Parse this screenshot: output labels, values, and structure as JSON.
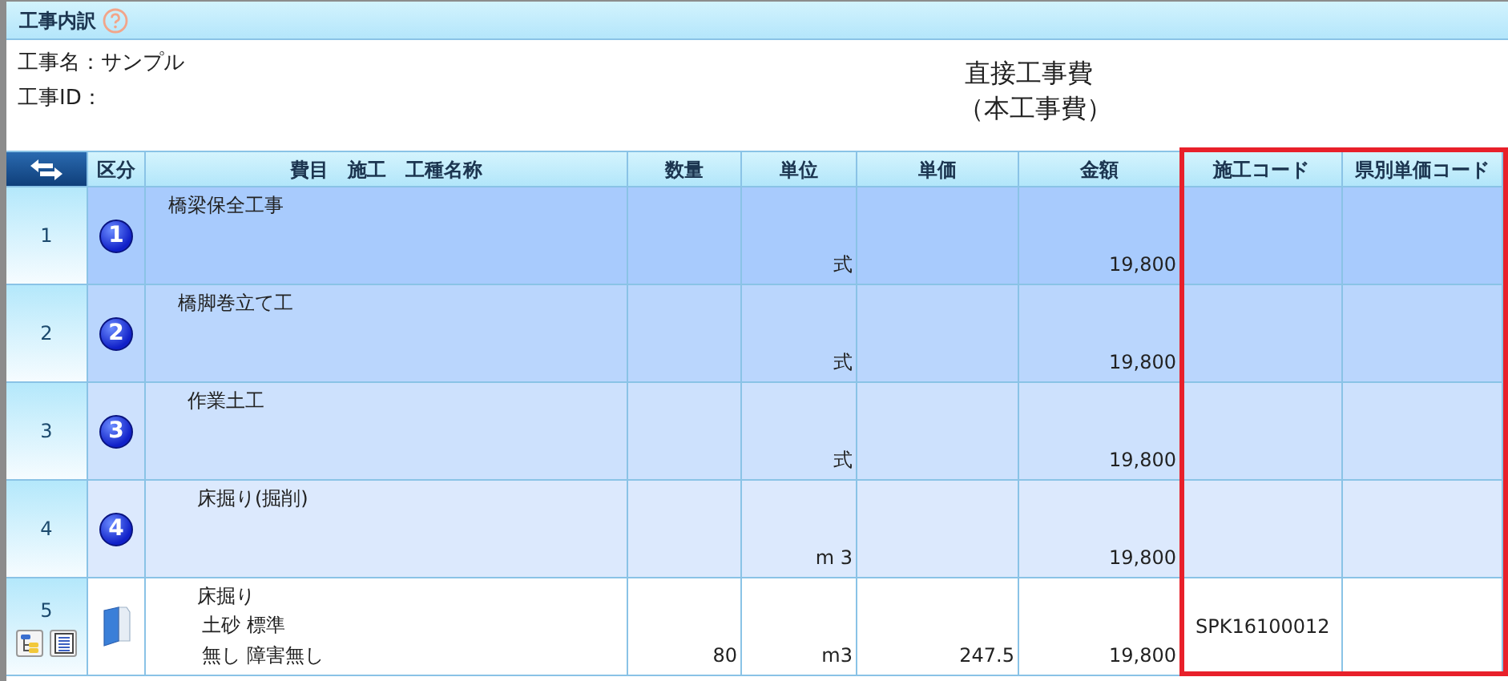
{
  "panel": {
    "title": "工事内訳"
  },
  "info": {
    "lines": [
      "工事名：サンプル",
      "工事ID："
    ],
    "heading": [
      "直接工事費",
      "（本工事費）"
    ]
  },
  "table": {
    "columns": [
      "区分",
      "費目　施工　工種名称",
      "数量",
      "単位",
      "単価",
      "金額",
      "施工コード",
      "県別単価コード"
    ],
    "rows": [
      {
        "no": "1",
        "kind": "group",
        "badge": "1",
        "name": "橋梁保全工事",
        "unit": "式",
        "amount": "19,800",
        "children": [
          {
            "no": "2",
            "kind": "group",
            "badge": "2",
            "name": "橋脚巻立て工",
            "unit": "式",
            "amount": "19,800",
            "children": [
              {
                "no": "3",
                "kind": "group",
                "badge": "3",
                "name": "作業土工",
                "unit": "式",
                "amount": "19,800",
                "children": [
                  {
                    "no": "4",
                    "kind": "group",
                    "badge": "4",
                    "name": "床掘り(掘削)",
                    "unit": "m 3",
                    "amount": "19,800",
                    "children": [
                      {
                        "no": "5",
                        "kind": "item",
                        "name": "床掘り",
                        "details": [
                          "土砂 標準",
                          "無し 障害無し"
                        ],
                        "quantity": "80",
                        "unit": "m3",
                        "price": "247.5",
                        "amount": "19,800",
                        "code": "SPK16100012"
                      }
                    ]
                  }
                ]
              }
            ]
          }
        ]
      }
    ]
  }
}
